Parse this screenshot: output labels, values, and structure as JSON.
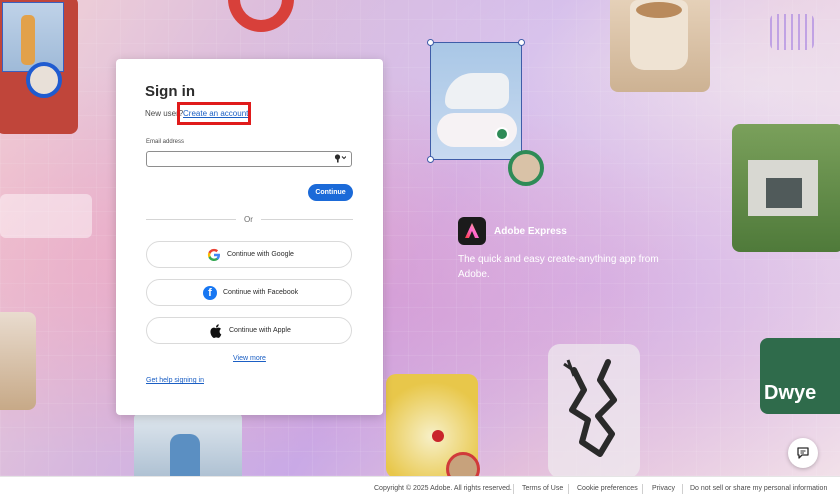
{
  "signin": {
    "title": "Sign in",
    "new_user_text": "New user?",
    "create_account_link": "Create an account",
    "email_label": "Email address",
    "email_value": "",
    "continue_label": "Continue",
    "or_label": "Or",
    "google_label": "Continue with Google",
    "facebook_label": "Continue with Facebook",
    "apple_label": "Continue with Apple",
    "view_more_link": "View more",
    "help_link": "Get help signing in"
  },
  "promo": {
    "app_name": "Adobe Express",
    "description": "The quick and easy create-anything app from Adobe."
  },
  "decor": {
    "dwyer_text": "Dwye"
  },
  "footer": {
    "copyright": "Copyright © 2025 Adobe. All rights reserved.",
    "terms": "Terms of Use",
    "cookies": "Cookie preferences",
    "privacy": "Privacy",
    "do_not_sell": "Do not sell or share my personal information"
  },
  "colors": {
    "accent": "#1b6ad8",
    "highlight": "#e01b1b",
    "facebook": "#1877f2"
  },
  "icons": {
    "email_field": "key-icon",
    "chat": "chat-icon",
    "google": "google-icon",
    "facebook": "facebook-icon",
    "apple": "apple-icon",
    "adobe_express": "adobe-express-logo"
  }
}
